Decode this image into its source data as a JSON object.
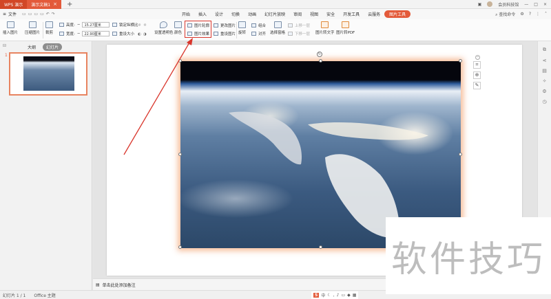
{
  "titlebar": {
    "app_tab": "WPS 演示",
    "doc_tab": "演示文稿1",
    "user": "会员科技馆",
    "controls": [
      "—",
      "□",
      "×"
    ]
  },
  "menubar": {
    "file_label": "文件",
    "menus": [
      "开始",
      "插入",
      "设计",
      "切换",
      "动画",
      "幻灯片放映",
      "审阅",
      "视图",
      "安全",
      "开发工具",
      "云服务",
      "图片工具"
    ],
    "active_menu": "图片工具",
    "search_label": "查找命令"
  },
  "ribbon": {
    "insert_picture": "插入图片",
    "compress_picture": "压缩图片",
    "crop": "裁剪",
    "height_label": "高度:",
    "height_value": "15.27厘米",
    "width_label": "宽度:",
    "width_value": "22.90厘米",
    "lock_ratio": "锁定纵横比",
    "reset_size": "重设大小",
    "set_transparent": "设置透明色",
    "color": "颜色",
    "picture_outline": "图片轮廓",
    "picture_effects": "图片效果",
    "change_picture": "更改图片",
    "reset_picture": "重设图片",
    "rotate": "旋转",
    "group": "组合",
    "align": "对齐",
    "selection_pane": "选择窗格",
    "bring_forward": "上移一层",
    "send_backward": "下移一层",
    "picture_to_text": "图片转文字",
    "picture_to_pdf": "图片转PDF"
  },
  "leftpanel": {
    "tab_outline": "大纲",
    "tab_slides": "幻灯片",
    "slide_number": "1"
  },
  "notes": {
    "placeholder": "单击此处添加备注"
  },
  "statusbar": {
    "slide_info": "幻灯片 1 / 1",
    "theme": "Office 主题",
    "ime": "中"
  },
  "watermark": {
    "text": "软件技巧"
  },
  "colors": {
    "accent": "#e35a3a",
    "highlight_box": "#d9362c",
    "selection_glow": "#f5b48c"
  }
}
